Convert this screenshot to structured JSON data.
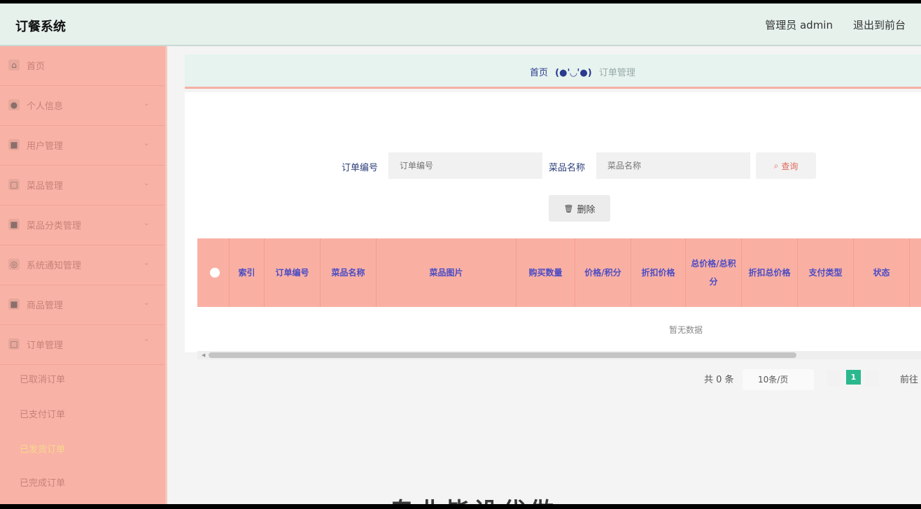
{
  "header": {
    "title": "订餐系统",
    "admin": "管理员 admin",
    "back": "退出到前台"
  },
  "sidebar": {
    "items": [
      {
        "label": "首页",
        "icon": "home-icon",
        "glyph": "⌂",
        "chevron": ""
      },
      {
        "label": "个人信息",
        "icon": "user-icon",
        "glyph": "●",
        "chevron": "⌄"
      },
      {
        "label": "用户管理",
        "icon": "users-icon",
        "glyph": "■",
        "chevron": "⌄"
      },
      {
        "label": "菜品管理",
        "icon": "dish-icon",
        "glyph": "□",
        "chevron": "⌄"
      },
      {
        "label": "菜品分类管理",
        "icon": "category-icon",
        "glyph": "■",
        "chevron": "⌄"
      },
      {
        "label": "系统通知管理",
        "icon": "notice-icon",
        "glyph": "◎",
        "chevron": "⌄"
      },
      {
        "label": "商品管理",
        "icon": "goods-icon",
        "glyph": "■",
        "chevron": "⌄"
      },
      {
        "label": "订单管理",
        "icon": "order-icon",
        "glyph": "□",
        "chevron": "⌃"
      }
    ],
    "sub_items": [
      "已取消订单",
      "已支付订单",
      "已发货订单",
      "已完成订单"
    ]
  },
  "breadcrumb": {
    "home": "首页",
    "face": "(●'◡'●)",
    "current": "订单管理"
  },
  "search": {
    "order_label": "订单编号",
    "order_placeholder": "订单编号",
    "dish_label": "菜品名称",
    "dish_placeholder": "菜品名称",
    "button": "查询",
    "search_glyph": "⌕"
  },
  "toolbar": {
    "delete": "删除",
    "delete_glyph": "🗑"
  },
  "table": {
    "headers": [
      "索引",
      "订单编号",
      "菜品名称",
      "菜品图片",
      "购买数量",
      "价格/积分",
      "折扣价格",
      "总价格/总积分",
      "折扣总价格",
      "支付类型",
      "状态"
    ],
    "empty_text": "暂无数据"
  },
  "pagination": {
    "total": "共 0 条",
    "page_size": "10条/页",
    "current_page": "1",
    "goto": "前往"
  },
  "watermark": "专业毕设代做",
  "colors": {
    "sidebar": "#f9b2a6",
    "header": "#e6f1ec",
    "accent": "#2bb88f",
    "table_head": "#f9b0a3"
  }
}
